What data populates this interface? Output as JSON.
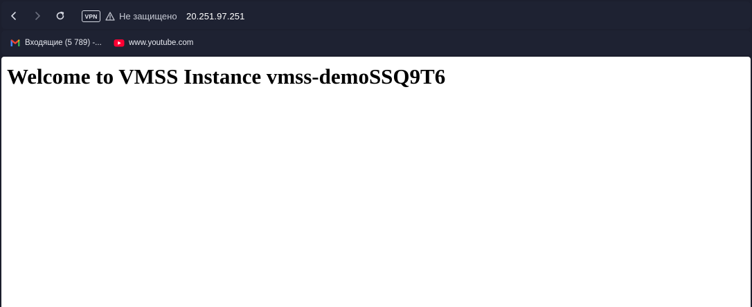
{
  "browser": {
    "toolbar": {
      "vpn_label": "VPN",
      "security_text": "Не защищено",
      "url": "20.251.97.251",
      "icons": [
        "back-icon",
        "forward-icon",
        "reload-icon",
        "warning-icon"
      ]
    },
    "bookmarks": [
      {
        "label": "Входящие (5 789) -...",
        "icon": "gmail-icon"
      },
      {
        "label": "www.youtube.com",
        "icon": "youtube-icon"
      }
    ]
  },
  "page": {
    "heading": "Welcome to VMSS Instance vmss-demoSSQ9T6"
  },
  "colors": {
    "chrome_bg": "#1e2232",
    "page_bg": "#ffffff",
    "text_light": "#e6e8ef"
  }
}
